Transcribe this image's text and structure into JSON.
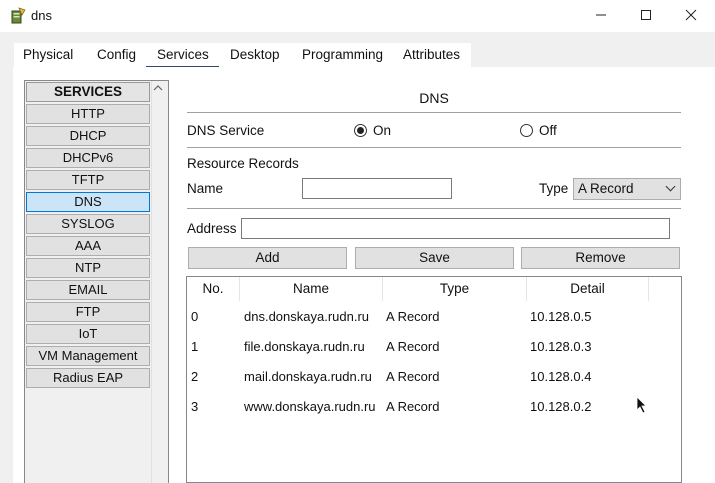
{
  "window": {
    "title": "dns",
    "controls": {
      "minimize": "—",
      "maximize": "☐",
      "close": "✕"
    },
    "icon": "packet-tracer-server-icon"
  },
  "tabs": [
    {
      "label": "Physical"
    },
    {
      "label": "Config"
    },
    {
      "label": "Services",
      "active": true
    },
    {
      "label": "Desktop"
    },
    {
      "label": "Programming"
    },
    {
      "label": "Attributes"
    }
  ],
  "services": {
    "header": "SERVICES",
    "items": [
      "HTTP",
      "DHCP",
      "DHCPv6",
      "TFTP",
      "DNS",
      "SYSLOG",
      "AAA",
      "NTP",
      "EMAIL",
      "FTP",
      "IoT",
      "VM Management",
      "Radius EAP"
    ],
    "selected": "DNS"
  },
  "dns": {
    "title": "DNS",
    "service_label": "DNS Service",
    "on_label": "On",
    "off_label": "Off",
    "service_state": "On",
    "resource_records_label": "Resource Records",
    "name_label": "Name",
    "name_value": "",
    "type_label": "Type",
    "type_value": "A Record",
    "address_label": "Address",
    "address_value": "",
    "add_button": "Add",
    "save_button": "Save",
    "remove_button": "Remove"
  },
  "records": {
    "columns": [
      "No.",
      "Name",
      "Type",
      "Detail"
    ],
    "rows": [
      {
        "no": "0",
        "name": "dns.donskaya.rudn.ru",
        "type": "A Record",
        "detail": "10.128.0.5"
      },
      {
        "no": "1",
        "name": "file.donskaya.rudn.ru",
        "type": "A Record",
        "detail": "10.128.0.3"
      },
      {
        "no": "2",
        "name": "mail.donskaya.rudn.ru",
        "type": "A Record",
        "detail": "10.128.0.4"
      },
      {
        "no": "3",
        "name": "www.donskaya.rudn.ru",
        "type": "A Record",
        "detail": "10.128.0.2"
      }
    ]
  },
  "colors": {
    "selected_item": "#cce4f7",
    "accent": "#0078d7",
    "tab_underline": "#2b4a7a"
  }
}
